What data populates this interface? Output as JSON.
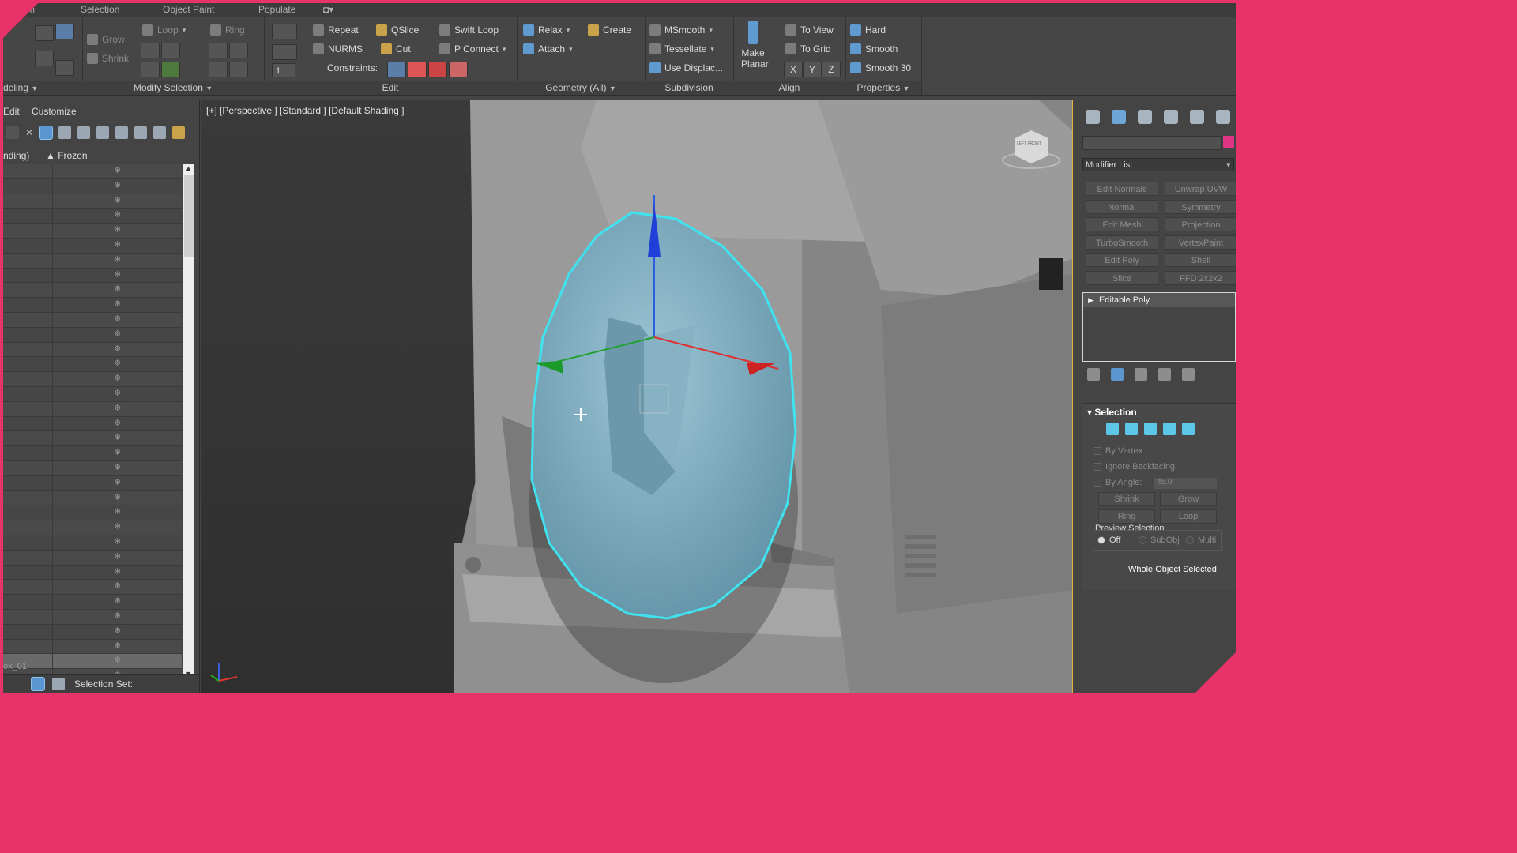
{
  "ribbon": {
    "tabs": [
      "m",
      "Selection",
      "Object Paint",
      "Populate"
    ],
    "groups": {
      "modeling_title": "deling",
      "modify_selection": {
        "title": "Modify Selection",
        "grow": "Grow",
        "shrink": "Shrink",
        "loop": "Loop",
        "ring": "Ring"
      },
      "edit": {
        "title": "Edit",
        "repeat": "Repeat",
        "qslice": "QSlice",
        "swift_loop": "Swift Loop",
        "nurms": "NURMS",
        "cut": "Cut",
        "p_connect": "P Connect",
        "constraints": "Constraints:",
        "spinner_value": "1"
      },
      "geometry": {
        "title": "Geometry (All)",
        "relax": "Relax",
        "create": "Create",
        "attach": "Attach"
      },
      "subdivision": {
        "title": "Subdivision",
        "msmooth": "MSmooth",
        "tessellate": "Tessellate",
        "use_displace": "Use Displac..."
      },
      "align": {
        "title": "Align",
        "make": "Make",
        "planar": "Planar",
        "to_view": "To View",
        "to_grid": "To Grid",
        "x": "X",
        "y": "Y",
        "z": "Z"
      },
      "properties": {
        "title": "Properties",
        "hard": "Hard",
        "smooth": "Smooth",
        "smooth30": "Smooth 30"
      }
    }
  },
  "explorer": {
    "menu_edit": "Edit",
    "menu_customize": "Customize",
    "col_name": "nding)",
    "col_frozen": "▲ Frozen",
    "row_count": 36,
    "frozen_glyph": "❄",
    "last_item": "ox_01",
    "selection_set_label": "Selection Set:"
  },
  "viewport": {
    "label": "[+] [Perspective ] [Standard ] [Default Shading ]",
    "viewcube_text": "LEFT FRONT"
  },
  "command_panel": {
    "modifier_list": "Modifier List",
    "modifier_buttons": [
      "Edit Normals",
      "Unwrap UVW",
      "Normal",
      "Symmetry",
      "Edit Mesh",
      "Projection",
      "TurboSmooth",
      "VertexPaint",
      "Edit Poly",
      "Shell",
      "Slice",
      "FFD 2x2x2"
    ],
    "stack_item": "Editable Poly",
    "selection": {
      "title": "Selection",
      "by_vertex": "By Vertex",
      "ignore_backfacing": "Ignore Backfacing",
      "by_angle": "By Angle:",
      "angle_value": "45.0",
      "shrink": "Shrink",
      "grow": "Grow",
      "ring": "Ring",
      "loop": "Loop",
      "preview_title": "Preview Selection",
      "off": "Off",
      "subobj": "SubObj",
      "multi": "Multi",
      "status": "Whole Object Selected"
    }
  },
  "colors": {
    "accent_frame": "#e8336a",
    "selection_outline": "#3fe3f0",
    "selected_object": "#7fb0c4"
  }
}
